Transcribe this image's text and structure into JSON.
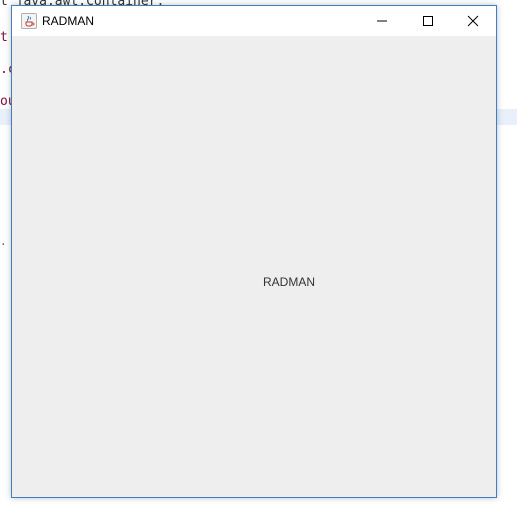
{
  "background_editor": {
    "lines": [
      "t java.awt.Container;",
      "t",
      ".c",
      "ou"
    ]
  },
  "window": {
    "title": "RADMAN",
    "app_icon": "java-cup-icon",
    "controls": {
      "minimize_icon": "minimize-icon",
      "maximize_icon": "maximize-icon",
      "close_icon": "close-icon"
    },
    "content": {
      "label": "RADMAN"
    },
    "colors": {
      "border": "#3a7fc7",
      "content_bg": "#eeeeee",
      "titlebar_bg": "#ffffff"
    }
  }
}
